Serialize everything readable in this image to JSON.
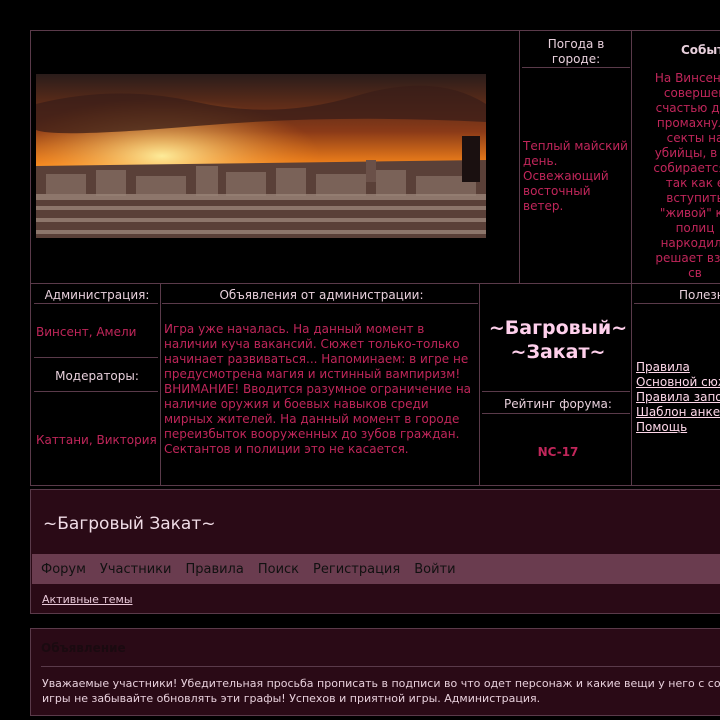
{
  "weather": {
    "title": "Погода в городе:",
    "text": "Теплый майский день. Освежающий восточный ветер."
  },
  "events": {
    "title": "Событ",
    "text": "На Винсента\nсовершен\nсчастью для\nпромахнуло\nсекты на\nубийцы, в то\nсобирается у\nтак как е\nвступить\n\"живой\" ко\nполиц\nнаркодилл\nрешает взят\nсв"
  },
  "administration": {
    "title": "Администрация:",
    "names": "Винсент, Амели",
    "moderators_title": "Модераторы:",
    "moderators_names": "Каттани, Виктория"
  },
  "announcements": {
    "title": "Объявления от администрации:",
    "text": "Игра уже началась. На данный момент в наличии куча вакансий. Сюжет только-только начинает развиваться... Напоминаем: в игре не предусмотрена магия и истинный вампиризм! ВНИМАНИЕ! Вводится разумное ограничение на наличие оружия и боевых навыков среди мирных жителей. На данный момент в городе переизбыток вооруженных до зубов граждан. Сектантов и полиции это не касается."
  },
  "center": {
    "forum_name": "~Багровый~ ~Закат~",
    "rating_title": "Рейтинг форума:",
    "rating_value": "NC-17"
  },
  "useful": {
    "title": "Полезн",
    "links": [
      "Правила",
      "Основной сюж",
      "Правила запо",
      "Шаблон анкет",
      "Помощь"
    ]
  },
  "forum_header": {
    "title": "~Багровый Закат~",
    "nav": [
      "Форум",
      "Участники",
      "Правила",
      "Поиск",
      "Регистрация",
      "Войти"
    ],
    "active_topics": "Активные темы"
  },
  "announce_block": {
    "title": "Объявление",
    "text": "Уважаемые участники! Убедительная просьба прописать в подписи во что одет персонаж и какие вещи у него с со игры не забывайте обновлять эти графы! Успехов и приятной игры. Администрация."
  },
  "colors": {
    "accent_red": "#c0265a",
    "nav_bar": "#6a3c4f",
    "panel_bg": "#2a0a16"
  }
}
